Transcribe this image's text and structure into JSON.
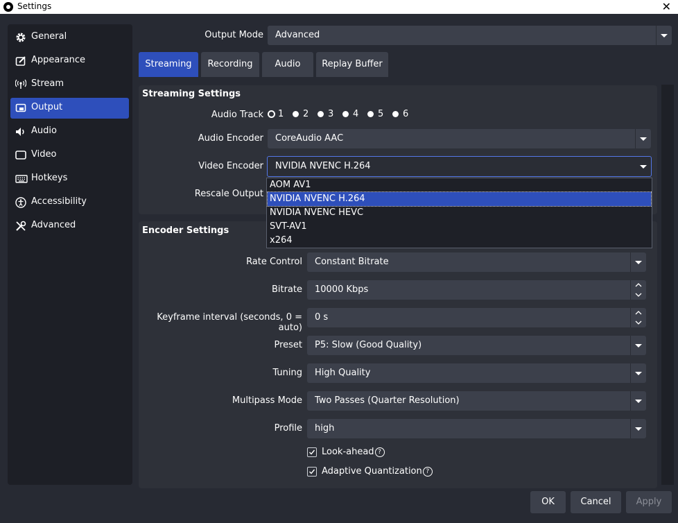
{
  "window": {
    "title": "Settings",
    "close_glyph": "✕"
  },
  "sidebar": {
    "items": [
      {
        "label": "General",
        "icon": "gear-icon"
      },
      {
        "label": "Appearance",
        "icon": "appearance-icon"
      },
      {
        "label": "Stream",
        "icon": "broadcast-icon"
      },
      {
        "label": "Output",
        "icon": "output-icon",
        "active": true
      },
      {
        "label": "Audio",
        "icon": "speaker-icon"
      },
      {
        "label": "Video",
        "icon": "monitor-icon"
      },
      {
        "label": "Hotkeys",
        "icon": "keyboard-icon"
      },
      {
        "label": "Accessibility",
        "icon": "accessibility-icon"
      },
      {
        "label": "Advanced",
        "icon": "tools-icon"
      }
    ]
  },
  "output_mode": {
    "label": "Output Mode",
    "value": "Advanced"
  },
  "tabs": [
    "Streaming",
    "Recording",
    "Audio",
    "Replay Buffer"
  ],
  "active_tab": "Streaming",
  "streaming_settings": {
    "title": "Streaming Settings",
    "audio_track": {
      "label": "Audio Track",
      "options": [
        "1",
        "2",
        "3",
        "4",
        "5",
        "6"
      ],
      "selected": "1"
    },
    "audio_encoder": {
      "label": "Audio Encoder",
      "value": "CoreAudio AAC"
    },
    "video_encoder": {
      "label": "Video Encoder",
      "value": "NVIDIA NVENC H.264",
      "options": [
        "AOM AV1",
        "NVIDIA NVENC H.264",
        "NVIDIA NVENC HEVC",
        "SVT-AV1",
        "x264"
      ],
      "selected": "NVIDIA NVENC H.264"
    },
    "rescale_output": {
      "label": "Rescale Output"
    }
  },
  "encoder_settings": {
    "title": "Encoder Settings",
    "rate_control": {
      "label": "Rate Control",
      "value": "Constant Bitrate"
    },
    "bitrate": {
      "label": "Bitrate",
      "value": "10000 Kbps"
    },
    "keyframe_interval": {
      "label": "Keyframe interval (seconds, 0 = auto)",
      "value": "0 s"
    },
    "preset": {
      "label": "Preset",
      "value": "P5: Slow (Good Quality)"
    },
    "tuning": {
      "label": "Tuning",
      "value": "High Quality"
    },
    "multipass": {
      "label": "Multipass Mode",
      "value": "Two Passes (Quarter Resolution)"
    },
    "profile": {
      "label": "Profile",
      "value": "high"
    },
    "look_ahead": {
      "label": "Look-ahead",
      "checked": true
    },
    "adaptive_quantization": {
      "label": "Adaptive Quantization",
      "checked": true
    },
    "help_glyph": "?"
  },
  "buttons": {
    "ok": "OK",
    "cancel": "Cancel",
    "apply": "Apply"
  },
  "colors": {
    "accent": "#2e4fbb",
    "background": "#272a33",
    "panel": "#2e3139",
    "input": "#3c404b"
  }
}
